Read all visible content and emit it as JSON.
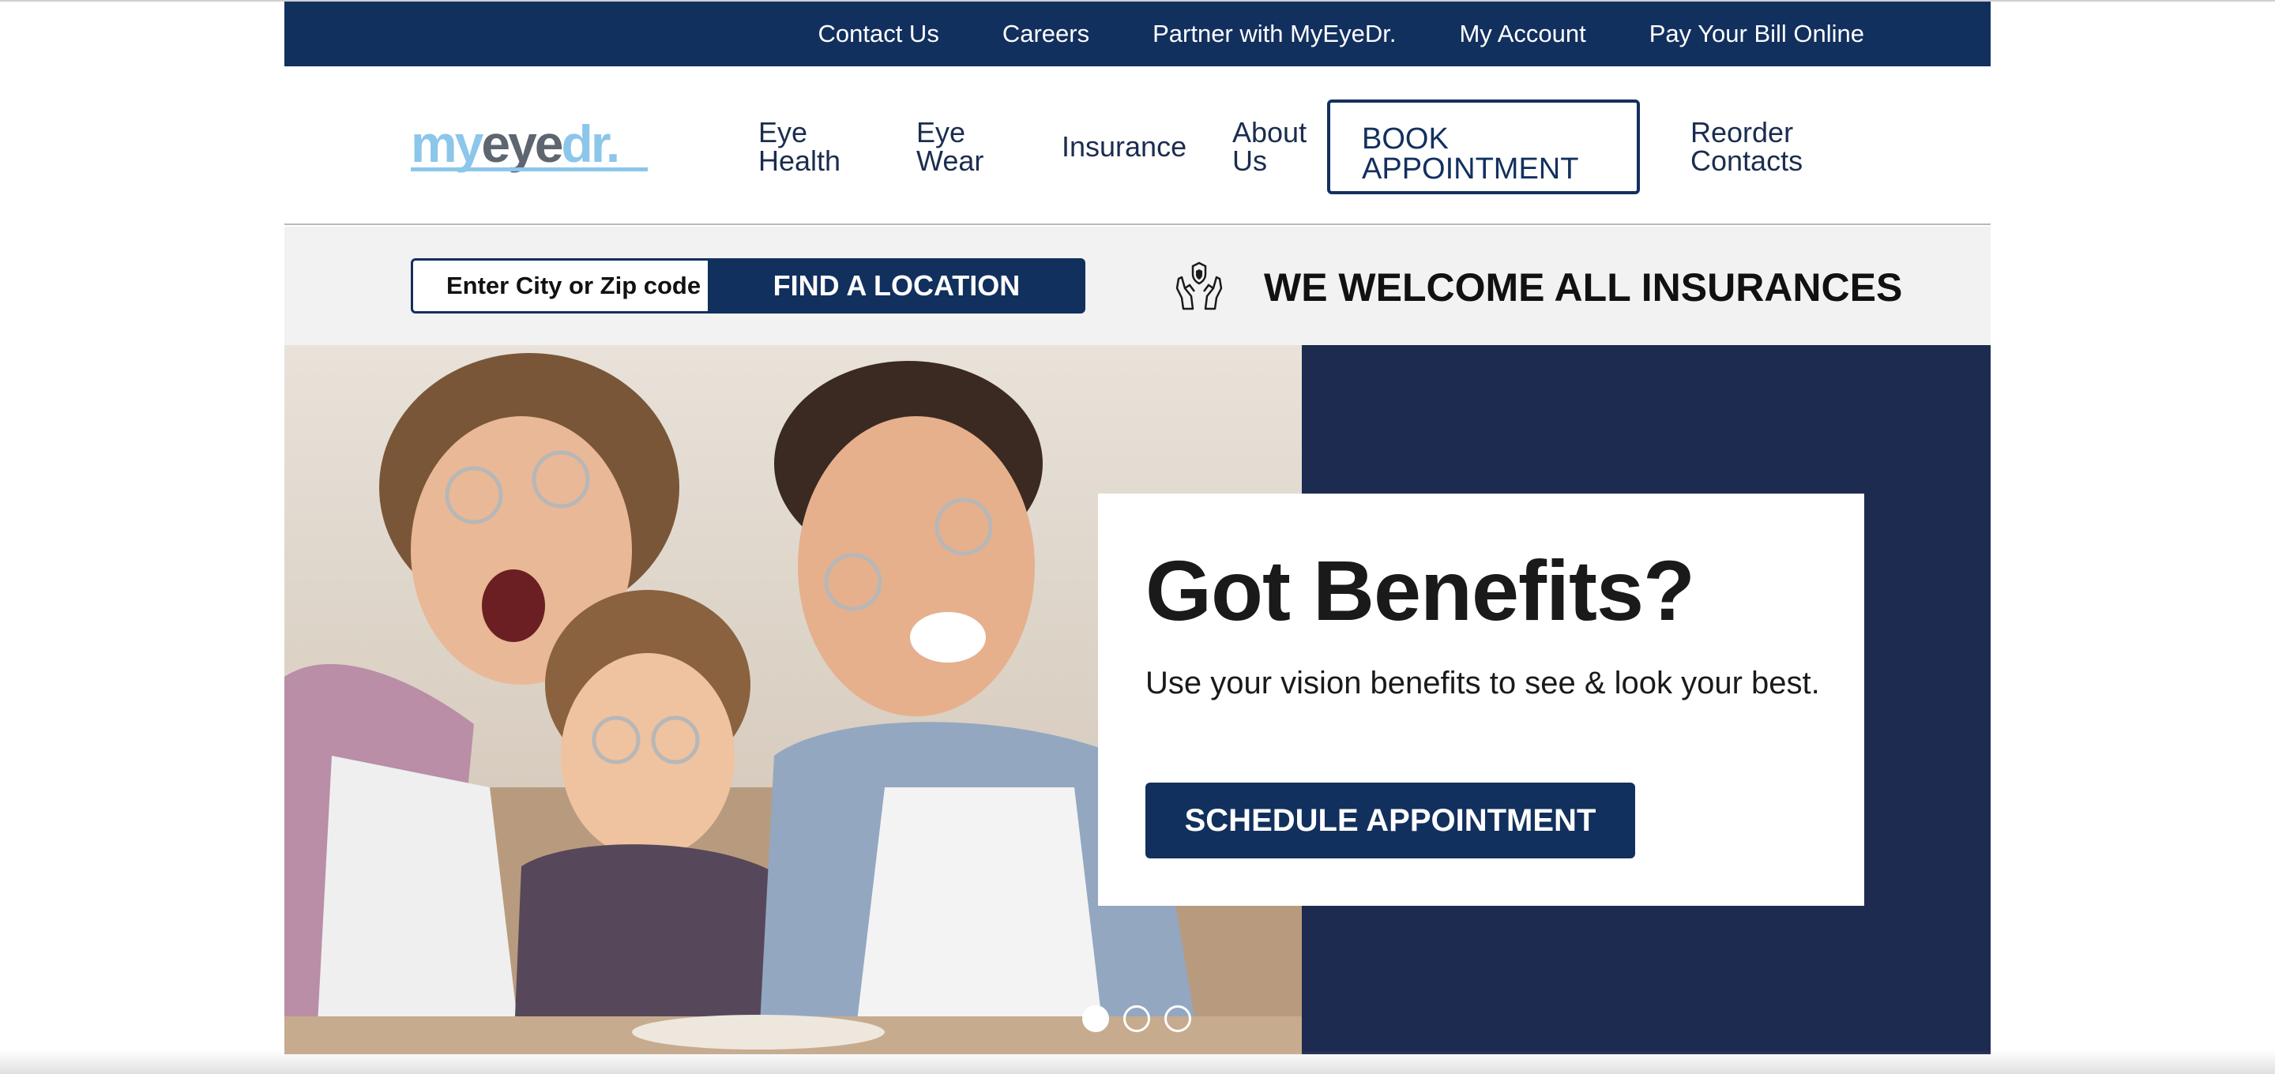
{
  "utility_nav": {
    "links": [
      "Contact Us",
      "Careers",
      "Partner with MyEyeDr.",
      "My Account",
      "Pay Your Bill Online"
    ]
  },
  "header": {
    "logo": {
      "part1": "my",
      "part2": "eye",
      "part3": "dr.",
      "logo_color": "#8cc6ea",
      "logo_dark": "#5d6570"
    },
    "nav": {
      "eye_health": "Eye\nHealth",
      "eye_wear": "Eye\nWear",
      "insurance": "Insurance",
      "about_us": "About\nUs",
      "book_appointment": "BOOK\nAPPOINTMENT",
      "reorder_contacts": "Reorder\nContacts"
    }
  },
  "search": {
    "placeholder": "Enter City or Zip code",
    "button_label": "FIND A LOCATION",
    "insurance_icon": "hands-shield-icon",
    "insurance_message": "WE WELCOME ALL INSURANCES"
  },
  "hero": {
    "title": "Got Benefits?",
    "subtitle": "Use your vision benefits to see & look your best.",
    "button_label": "SCHEDULE APPOINTMENT",
    "carousel": {
      "slide_count": 3,
      "active_index": 0
    }
  },
  "colors": {
    "brand_navy": "#12305e",
    "panel_navy": "#1d2b51",
    "strip_gray": "#f2f2f2"
  }
}
